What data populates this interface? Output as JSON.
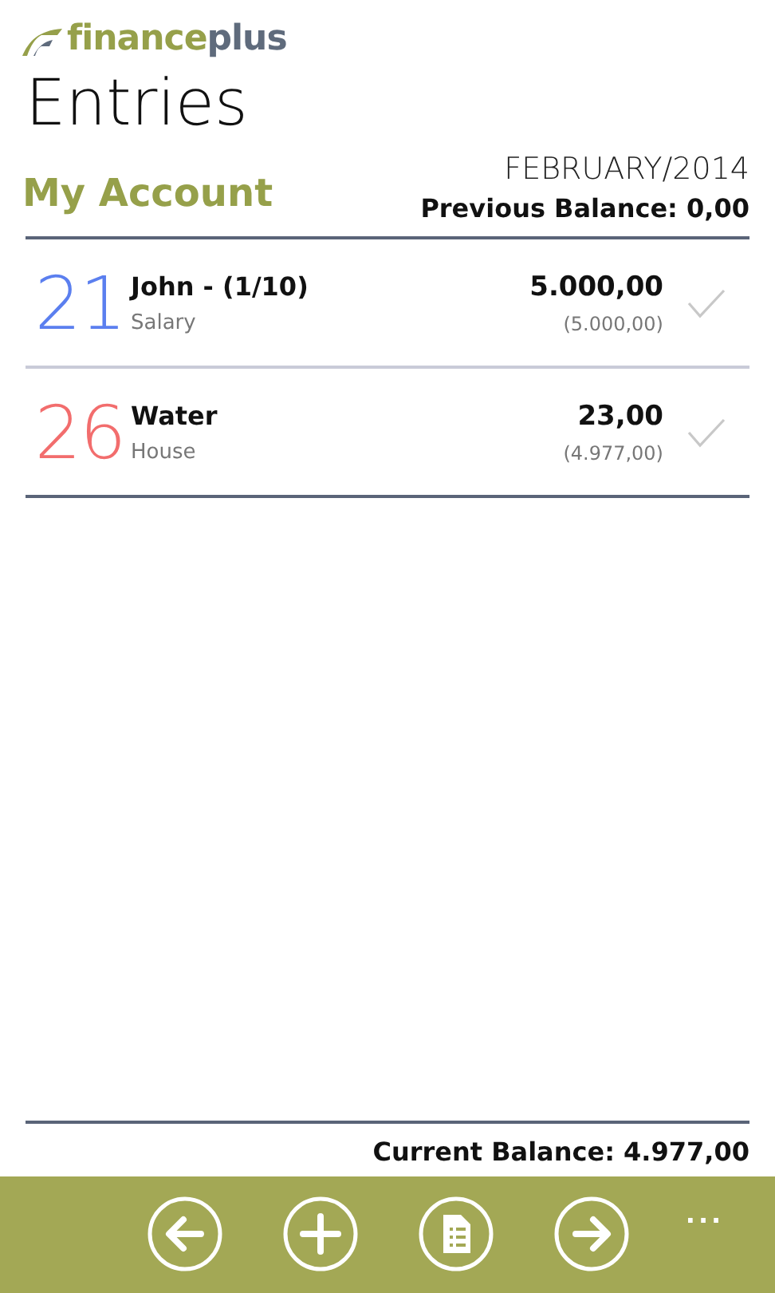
{
  "app": {
    "logo": [
      "finance",
      "plus"
    ],
    "title": "Entries"
  },
  "header": {
    "account": "My Account",
    "period": "FEBRUARY/2014",
    "previous_balance": "Previous Balance: 0,00"
  },
  "entries": [
    {
      "day": "21",
      "color": "#5b7fef",
      "title": "John - (1/10)",
      "category": "Salary",
      "amount": "5.000,00",
      "balance": "(5.000,00)"
    },
    {
      "day": "26",
      "color": "#f26d6d",
      "title": "Water",
      "category": "House",
      "amount": "23,00",
      "balance": "(4.977,00)"
    }
  ],
  "current_balance": "Current Balance: 4.977,00",
  "app_bar": {
    "buttons": [
      {
        "kind": "back"
      },
      {
        "kind": "add"
      },
      {
        "kind": "report"
      },
      {
        "kind": "forward"
      }
    ],
    "more": "..."
  }
}
